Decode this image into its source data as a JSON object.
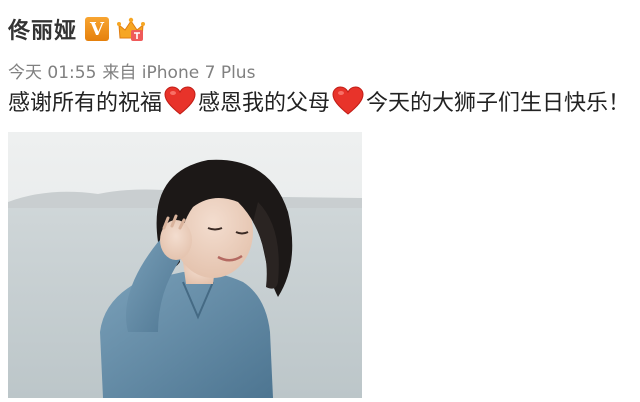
{
  "post": {
    "username": "佟丽娅",
    "verified_badge": "V",
    "member_icon": "crown-member-icon",
    "time": "今天 01:55",
    "source": "来自 iPhone 7 Plus",
    "text_part1": "感谢所有的祝福",
    "text_part2": "感恩我的父母",
    "text_part3": "今天的大狮子们生日快乐！",
    "heart_icon": "red-heart-icon",
    "photo": {
      "subject": "short-haired woman in denim shirt by the sea",
      "sky_color": "#e4e7e8",
      "sea_color": "#c7d0d3",
      "shirt_color": "#5d86a3",
      "hair_color": "#1a1716"
    }
  }
}
